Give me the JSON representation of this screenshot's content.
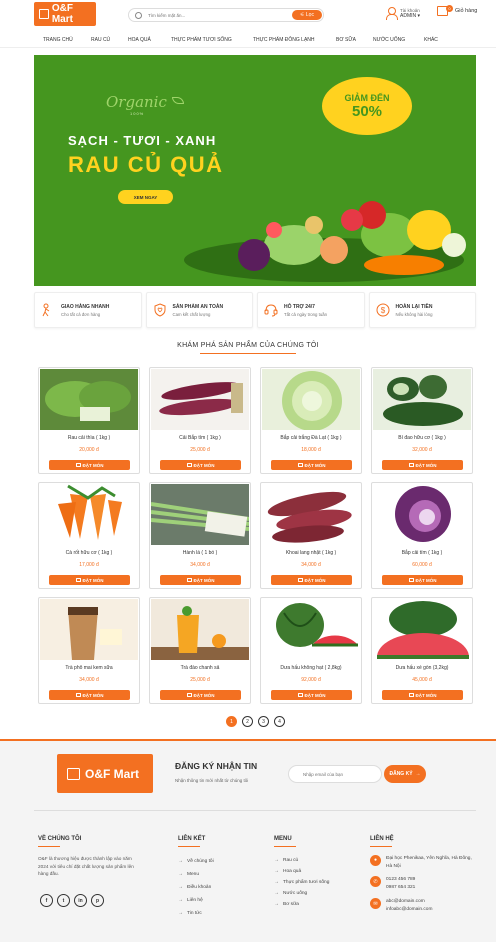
{
  "header": {
    "logo": "O&F Mart",
    "search_placeholder": "Tìm kiếm mặt ăn...",
    "filter_label": "Lọc",
    "account_label": "Tài khoản",
    "account_name": "ADMIN",
    "cart_label": "Giỏ hàng",
    "cart_count": "0"
  },
  "nav": [
    "TRANG CHỦ",
    "RAU CỦ",
    "HOA QUẢ",
    "THỰC PHẨM TƯƠI SỐNG",
    "THỰC PHẨM ĐÔNG LẠNH",
    "BƠ SỮA",
    "NƯỚC UỐNG",
    "KHÁC"
  ],
  "banner": {
    "organic": "Organic",
    "organic_sub": "100%",
    "tagline": "SẠCH - TƯƠI - XANH",
    "headline": "RAU CỦ QUẢ",
    "cta": "XEM NGAY",
    "promo_top": "GIẢM ĐẾN",
    "promo_value": "50%"
  },
  "features": [
    {
      "title": "GIAO HÀNG NHANH",
      "sub": "Cho tất cả đơn hàng",
      "icon": "delivery-icon"
    },
    {
      "title": "SẢN PHẨM AN TOÀN",
      "sub": "Cam kết chất lượng",
      "icon": "shield-icon"
    },
    {
      "title": "HỖ TRỢ 24/7",
      "sub": "Tất cả ngày trong tuần",
      "icon": "headset-icon"
    },
    {
      "title": "HOÀN LẠI TIỀN",
      "sub": "Nếu không hài lòng",
      "icon": "dollar-icon"
    }
  ],
  "section_title": "KHÁM PHÁ SẢN PHẨM CỦA CHÚNG TÔI",
  "order_label": "ĐẶT MÓN",
  "products": [
    {
      "name": "Rau cải thìa ( 1kg )",
      "price": "20,000 đ"
    },
    {
      "name": "Cải Bắp tím ( 1kg )",
      "price": "25,000 đ"
    },
    {
      "name": "Bắp cải trắng Đà Lạt ( 1kg )",
      "price": "18,000 đ"
    },
    {
      "name": "Bí đao hữu cơ ( 1kg )",
      "price": "32,000 đ"
    },
    {
      "name": "Cà rốt hữu cơ ( 1kg )",
      "price": "17,000 đ"
    },
    {
      "name": "Hành lá ( 1 bó )",
      "price": "34,000 đ"
    },
    {
      "name": "Khoai lang nhật ( 1kg )",
      "price": "34,000 đ"
    },
    {
      "name": "Bắp cải tím ( 1kg )",
      "price": "60,000 đ"
    },
    {
      "name": "Trà phô mai kem sữa",
      "price": "34,000 đ"
    },
    {
      "name": "Trà đào chanh sả",
      "price": "25,000 đ"
    },
    {
      "name": "Dưa hấu không hạt ( 2,8kg)",
      "price": "92,000 đ"
    },
    {
      "name": "Dưa hấu xé gòn (3,2kg)",
      "price": "45,000 đ"
    }
  ],
  "pages": [
    "1",
    "2",
    "3",
    "4"
  ],
  "newsletter": {
    "logo": "O&F Mart",
    "title": "ĐĂNG KÝ NHẬN TIN",
    "sub": "Nhận thông tin mới nhất từ chúng tôi",
    "placeholder": "Nhập email của bạn",
    "button": "ĐĂNG KÝ"
  },
  "footer": {
    "about_title": "VỀ CHÚNG TÔI",
    "about_text": "O&F là thương hiệu được thành lập vào năm 2024 với tiêu chí đặt chất lượng sản phẩm lên hàng đầu.",
    "socials": [
      "f",
      "t",
      "in",
      "p"
    ],
    "links_title": "LIÊN KẾT",
    "links": [
      "Về chúng tôi",
      "Menu",
      "Điều khoản",
      "Liên hệ",
      "Tin tức"
    ],
    "menu_title": "MENU",
    "menu": [
      "Rau củ",
      "Hoa quả",
      "Thực phẩm tươi sống",
      "Nước uống",
      "Bơ sữa"
    ],
    "contact_title": "LIÊN HỆ",
    "address": "Đại học Phenikaa, Yên Nghĩa, Hà Đông, Hà Nội",
    "phone1": "0123 456 789",
    "phone2": "0987 654 321",
    "email1": "abc@domain.com",
    "email2": "infoabc@domain.com"
  }
}
